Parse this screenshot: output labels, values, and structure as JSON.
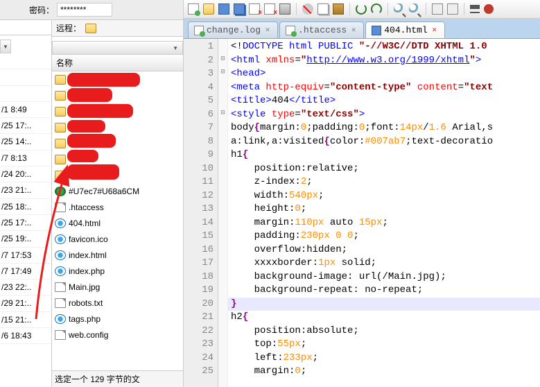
{
  "left": {
    "password_label": "密码：",
    "password_value": "********",
    "remote_label": "远程：",
    "name_header": "名称",
    "dates": [
      "",
      "",
      "",
      "/1 8:49",
      "/25 17:..",
      "/25 14:..",
      "/7 8:13",
      "/24 20:..",
      "/23 21:..",
      "/25 18:..",
      "/25 17:..",
      "/25 19:..",
      "/7 17:53",
      "/7 17:49",
      "/23 22:..",
      "/29 21:..",
      "/15 21:..",
      "/6 18:43"
    ],
    "files": [
      {
        "icon": "folder",
        "name": "",
        "redacted": true
      },
      {
        "icon": "folder",
        "name": "",
        "redacted": true
      },
      {
        "icon": "folder",
        "name": "",
        "redacted": true
      },
      {
        "icon": "folder",
        "name": "",
        "redacted": true
      },
      {
        "icon": "folder",
        "name": "",
        "redacted": true
      },
      {
        "icon": "folder",
        "name": "",
        "redacted": true
      },
      {
        "icon": "folder",
        "name": "",
        "redacted": true
      },
      {
        "icon": "globe",
        "name": "#U7ec7#U68a6CM"
      },
      {
        "icon": "file",
        "name": ".htaccess"
      },
      {
        "icon": "ie",
        "name": "404.html"
      },
      {
        "icon": "ie",
        "name": "favicon.ico"
      },
      {
        "icon": "ie",
        "name": "index.html"
      },
      {
        "icon": "ie",
        "name": "index.php"
      },
      {
        "icon": "file",
        "name": "Main.jpg"
      },
      {
        "icon": "file",
        "name": "robots.txt"
      },
      {
        "icon": "ie",
        "name": "tags.php"
      },
      {
        "icon": "file",
        "name": "web.config"
      }
    ],
    "status": "选定一个 129 字节的文"
  },
  "right": {
    "tabs": [
      {
        "label": "change.log",
        "active": false
      },
      {
        "label": ".htaccess",
        "active": false
      },
      {
        "label": "404.html",
        "active": true
      }
    ],
    "code_lines": [
      {
        "n": 1,
        "fold": "",
        "html": "<span class='c-dt'>&lt;!</span><span class='c-tag'>DOCTYPE html PUBLIC </span><span class='c-str'>\"-//W3C//DTD XHTML 1.0 </span>"
      },
      {
        "n": 2,
        "fold": "⊟",
        "html": "<span class='c-tag'>&lt;html </span><span class='c-attr'>xmlns</span>=<span class='c-str'>\"</span><span class='c-url'>http://www.w3.org/1999/xhtml</span><span class='c-str'>\"</span><span class='c-tag'>&gt;</span>"
      },
      {
        "n": 3,
        "fold": "⊟",
        "html": "<span class='c-tag'>&lt;head&gt;</span>"
      },
      {
        "n": 4,
        "fold": "",
        "html": "<span class='c-tag'>&lt;meta </span><span class='c-attr'>http-equiv</span>=<span class='c-str'>\"content-type\"</span> <span class='c-attr'>content</span>=<span class='c-str'>\"text</span>"
      },
      {
        "n": 5,
        "fold": "",
        "html": "<span class='c-tag'>&lt;title&gt;</span>404<span class='c-tag'>&lt;/title&gt;</span>"
      },
      {
        "n": 6,
        "fold": "⊟",
        "html": "<span class='c-tag'>&lt;style </span><span class='c-attr'>type</span>=<span class='c-str'>\"text/css\"</span><span class='c-tag'>&gt;</span>"
      },
      {
        "n": 7,
        "fold": "",
        "html": "<span class='c-sel'>body</span><span class='c-brace'>{</span>margin:<span class='c-num'>0</span>;padding:<span class='c-num'>0</span>;font:<span class='c-num'>14px</span>/<span class='c-num'>1.6</span> Arial,<span class='c-sel'>s</span>"
      },
      {
        "n": 8,
        "fold": "",
        "html": "<span class='c-sel'>a:link</span>,<span class='c-sel'>a:visited</span><span class='c-brace'>{</span>color:<span class='c-num'>#007ab7</span>;text-decoratio"
      },
      {
        "n": 9,
        "fold": "",
        "html": "<span class='c-sel'>h1</span><span class='c-brace'>{</span>"
      },
      {
        "n": 10,
        "fold": "",
        "html": "    position:relative;"
      },
      {
        "n": 11,
        "fold": "",
        "html": "    z-index:<span class='c-num'>2</span>;"
      },
      {
        "n": 12,
        "fold": "",
        "html": "    width:<span class='c-num'>540px</span>;"
      },
      {
        "n": 13,
        "fold": "",
        "html": "    height:<span class='c-num'>0</span>;"
      },
      {
        "n": 14,
        "fold": "",
        "html": "    margin:<span class='c-num'>110px</span> auto <span class='c-num'>15px</span>;"
      },
      {
        "n": 15,
        "fold": "",
        "html": "    padding:<span class='c-num'>230px 0 0</span>;"
      },
      {
        "n": 16,
        "fold": "",
        "html": "    overflow:hidden;"
      },
      {
        "n": 17,
        "fold": "",
        "html": "    xxxxborder:<span class='c-num'>1px</span> solid;"
      },
      {
        "n": 18,
        "fold": "",
        "html": "    background-image: url(/Main.jpg);"
      },
      {
        "n": 19,
        "fold": "",
        "html": "    background-repeat: no-repeat;"
      },
      {
        "n": 20,
        "fold": "",
        "html": "<span class='c-brace'>}</span>",
        "highlight": true
      },
      {
        "n": 21,
        "fold": "",
        "html": "<span class='c-sel'>h2</span><span class='c-brace'>{</span>"
      },
      {
        "n": 22,
        "fold": "",
        "html": "    position:absolute;"
      },
      {
        "n": 23,
        "fold": "",
        "html": "    top:<span class='c-num'>55px</span>;"
      },
      {
        "n": 24,
        "fold": "",
        "html": "    left:<span class='c-num'>233px</span>;"
      },
      {
        "n": 25,
        "fold": "",
        "html": "    margin:<span class='c-num'>0</span>;"
      }
    ]
  }
}
